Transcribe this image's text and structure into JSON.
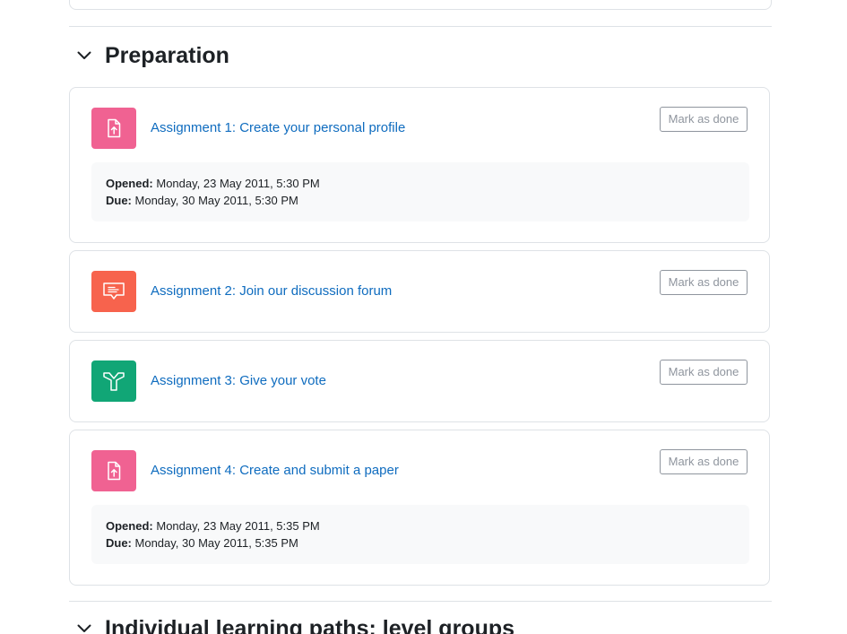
{
  "section_preparation": {
    "title": "Preparation"
  },
  "activities": [
    {
      "link": "Assignment 1: Create your personal profile",
      "mark_label": "Mark as done",
      "icon": "assignment-upload-icon",
      "icon_color": "#f06292",
      "opened_label": "Opened:",
      "opened_value": "Monday, 23 May 2011, 5:30 PM",
      "due_label": "Due:",
      "due_value": "Monday, 30 May 2011, 5:30 PM"
    },
    {
      "link": "Assignment 2: Join our discussion forum",
      "mark_label": "Mark as done",
      "icon": "forum-icon",
      "icon_color": "#f7634d"
    },
    {
      "link": "Assignment 3: Give your vote",
      "mark_label": "Mark as done",
      "icon": "choice-icon",
      "icon_color": "#11a676"
    },
    {
      "link": "Assignment 4: Create and submit a paper",
      "mark_label": "Mark as done",
      "icon": "assignment-upload-icon",
      "icon_color": "#f06292",
      "opened_label": "Opened:",
      "opened_value": "Monday, 23 May 2011, 5:35 PM",
      "due_label": "Due:",
      "due_value": "Monday, 30 May 2011, 5:35 PM"
    }
  ],
  "section_next": {
    "title": "Individual learning paths: level groups"
  }
}
